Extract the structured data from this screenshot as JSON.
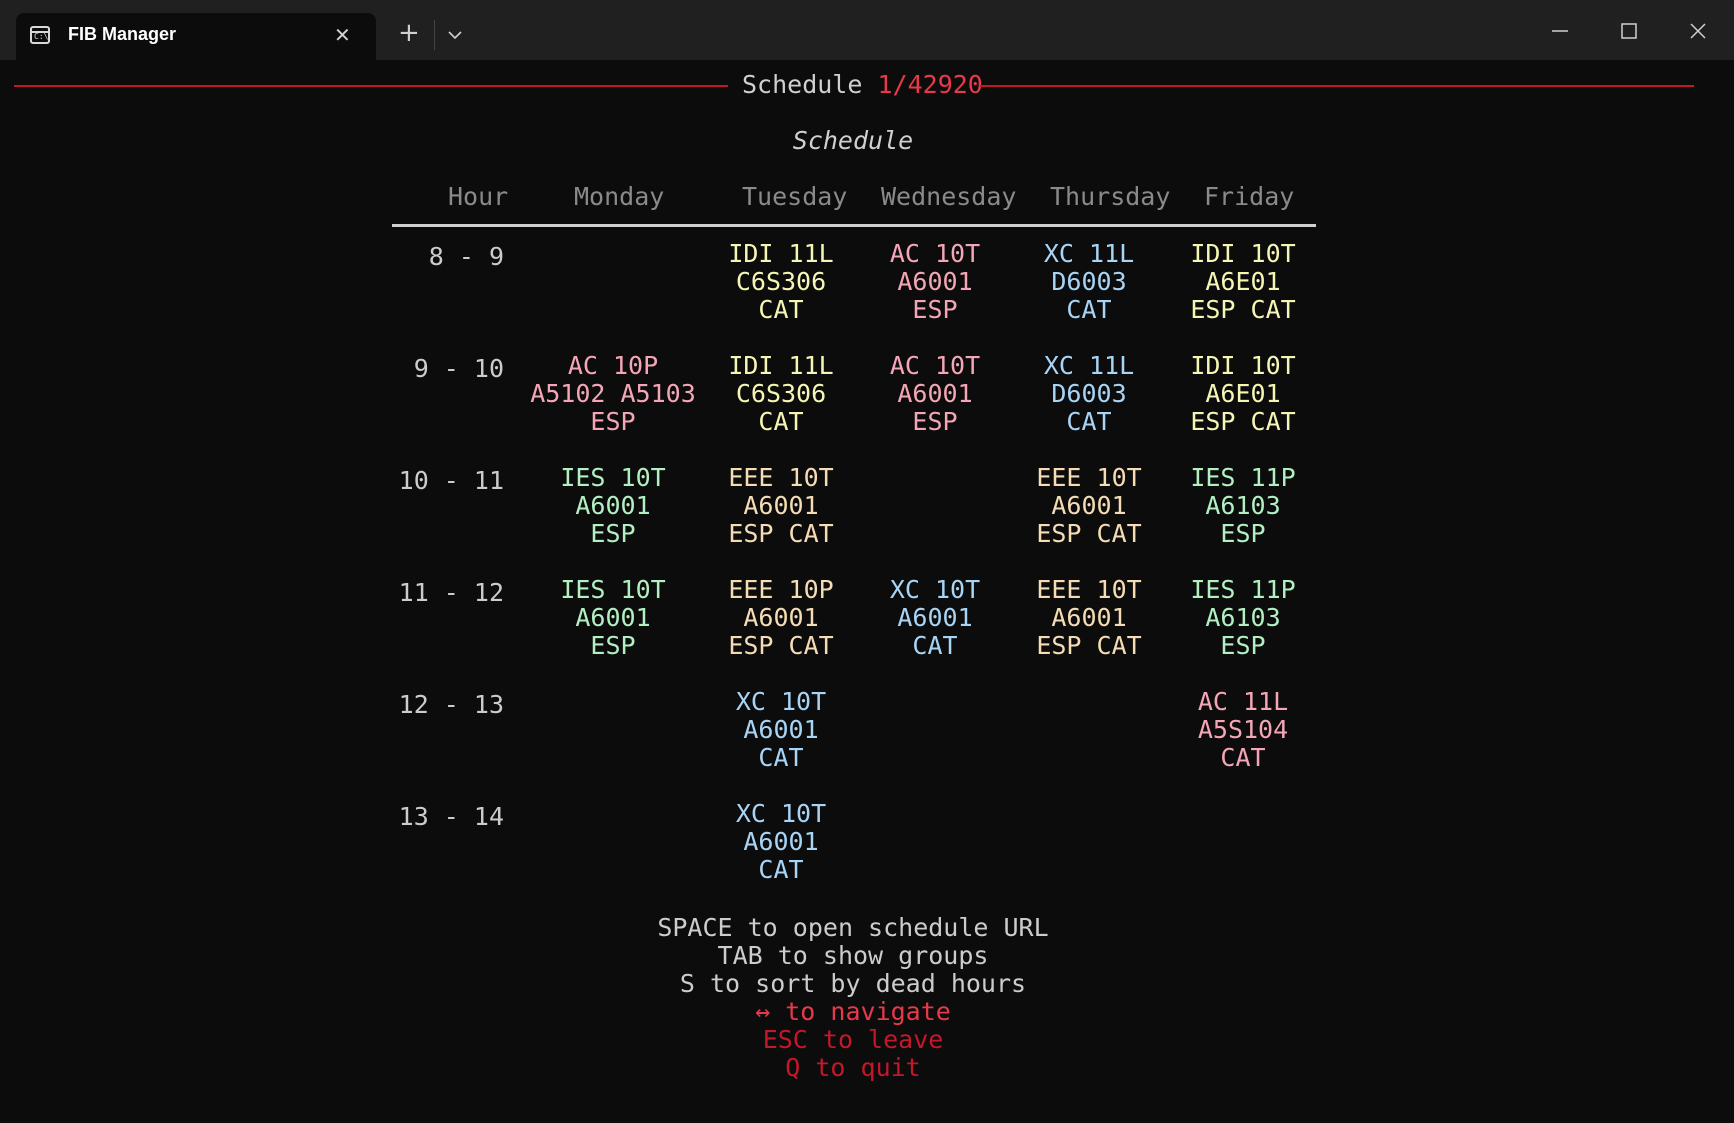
{
  "window": {
    "tab_title": "FIB Manager",
    "tab_icon": "terminal-icon",
    "colors": {
      "titlebar": "#202020",
      "background": "#0c0c0c",
      "accent": "#c3172a"
    }
  },
  "header": {
    "label": "Schedule",
    "index": "1",
    "total": "/42920"
  },
  "schedule": {
    "title": "Schedule",
    "columns": [
      "Hour",
      "Monday",
      "Tuesday",
      "Wednesday",
      "Thursday",
      "Friday"
    ],
    "hours": [
      "8 - 9",
      "9 - 10",
      "10 - 11",
      "11 - 12",
      "12 - 13",
      "13 - 14"
    ],
    "colors": {
      "IDI": "#f6f6b4",
      "AC": "#f4a6b6",
      "XC": "#a8d4f5",
      "IES": "#b2f0c2",
      "EEE": "#f6dcb4"
    },
    "rows": [
      {
        "cells": [
          null,
          {
            "subject": "IDI",
            "lines": [
              "IDI 11L",
              "C6S306",
              "CAT"
            ]
          },
          {
            "subject": "AC",
            "lines": [
              "AC 10T",
              "A6001",
              "ESP"
            ]
          },
          {
            "subject": "XC",
            "lines": [
              "XC 11L",
              "D6003",
              "CAT"
            ]
          },
          {
            "subject": "IDI",
            "lines": [
              "IDI 10T",
              "A6E01",
              "ESP CAT"
            ]
          }
        ]
      },
      {
        "cells": [
          {
            "subject": "AC",
            "lines": [
              "AC 10P",
              "A5102 A5103",
              "ESP"
            ]
          },
          {
            "subject": "IDI",
            "lines": [
              "IDI 11L",
              "C6S306",
              "CAT"
            ]
          },
          {
            "subject": "AC",
            "lines": [
              "AC 10T",
              "A6001",
              "ESP"
            ]
          },
          {
            "subject": "XC",
            "lines": [
              "XC 11L",
              "D6003",
              "CAT"
            ]
          },
          {
            "subject": "IDI",
            "lines": [
              "IDI 10T",
              "A6E01",
              "ESP CAT"
            ]
          }
        ]
      },
      {
        "cells": [
          {
            "subject": "IES",
            "lines": [
              "IES 10T",
              "A6001",
              "ESP"
            ]
          },
          {
            "subject": "EEE",
            "lines": [
              "EEE 10T",
              "A6001",
              "ESP CAT"
            ]
          },
          null,
          {
            "subject": "EEE",
            "lines": [
              "EEE 10T",
              "A6001",
              "ESP CAT"
            ]
          },
          {
            "subject": "IES",
            "lines": [
              "IES 11P",
              "A6103",
              "ESP"
            ]
          }
        ]
      },
      {
        "cells": [
          {
            "subject": "IES",
            "lines": [
              "IES 10T",
              "A6001",
              "ESP"
            ]
          },
          {
            "subject": "EEE",
            "lines": [
              "EEE 10P",
              "A6001",
              "ESP CAT"
            ]
          },
          {
            "subject": "XC",
            "lines": [
              "XC 10T",
              "A6001",
              "CAT"
            ]
          },
          {
            "subject": "EEE",
            "lines": [
              "EEE 10T",
              "A6001",
              "ESP CAT"
            ]
          },
          {
            "subject": "IES",
            "lines": [
              "IES 11P",
              "A6103",
              "ESP"
            ]
          }
        ]
      },
      {
        "cells": [
          null,
          {
            "subject": "XC",
            "lines": [
              "XC 10T",
              "A6001",
              "CAT"
            ]
          },
          null,
          null,
          {
            "subject": "AC",
            "lines": [
              "AC 11L",
              "A5S104",
              "CAT"
            ]
          }
        ]
      },
      {
        "cells": [
          null,
          {
            "subject": "XC",
            "lines": [
              "XC 10T",
              "A6001",
              "CAT"
            ]
          },
          null,
          null,
          null
        ]
      }
    ]
  },
  "help": [
    {
      "text": "SPACE to open schedule URL",
      "color": "#cccccc"
    },
    {
      "text": "TAB to show groups",
      "color": "#cccccc"
    },
    {
      "text": "S to sort by dead hours",
      "color": "#cccccc"
    },
    {
      "text": "↔ to navigate",
      "color": "#e8394b"
    },
    {
      "text": "ESC to leave",
      "color": "#c3172a"
    },
    {
      "text": "Q to quit",
      "color": "#c3172a"
    }
  ]
}
